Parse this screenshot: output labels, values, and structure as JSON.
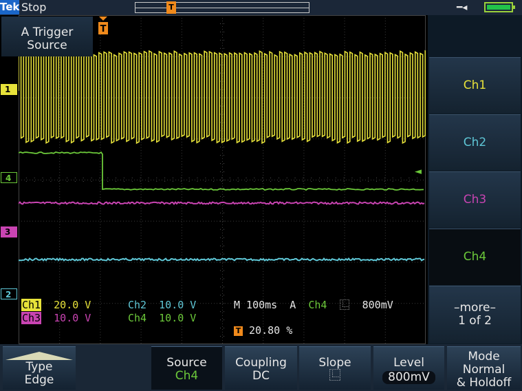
{
  "status_bar": {
    "brand": "Tek",
    "acquisition_state": "Stop",
    "trigger_marker": "T",
    "power_icon": "ac-plug-icon",
    "battery_icon": "battery-icon"
  },
  "screen": {
    "channel_markers": [
      "1",
      "4",
      "3",
      "2"
    ],
    "trigger_level_arrow": "◄"
  },
  "readouts": {
    "ch1_tag": "Ch1",
    "ch1_scale": "20.0 V",
    "ch2_tag": "Ch2",
    "ch2_scale": "10.0 V",
    "ch3_tag": "Ch3",
    "ch3_scale": "10.0 V",
    "ch4_tag": "Ch4",
    "ch4_scale": "10.0 V",
    "timebase": "M 100ms",
    "trigger_mode": "A",
    "trigger_source": "Ch4",
    "trigger_slope_symbol": "⿺",
    "trigger_level": "800mV",
    "trigger_position": "20.80 %"
  },
  "side_menu": {
    "title_line1": "A Trigger",
    "title_line2": "Source",
    "options": [
      "Ch1",
      "Ch2",
      "Ch3",
      "Ch4"
    ],
    "more_line1": "–more–",
    "more_line2": "1 of 2",
    "selected": "Ch4"
  },
  "bottom_menu": {
    "type_label": "Type",
    "type_value": "Edge",
    "source_label": "Source",
    "source_value": "Ch4",
    "coupling_label": "Coupling",
    "coupling_value": "DC",
    "slope_label": "Slope",
    "slope_value": "⿺",
    "level_label": "Level",
    "level_value": "800mV",
    "mode_line1": "Mode",
    "mode_line2": "Normal",
    "mode_line3": "& Holdoff"
  },
  "colors": {
    "ch1": "#e7e23a",
    "ch2": "#5fc7d6",
    "ch3": "#c944b2",
    "ch4": "#6cc93a",
    "trigger": "#f08a1c"
  }
}
